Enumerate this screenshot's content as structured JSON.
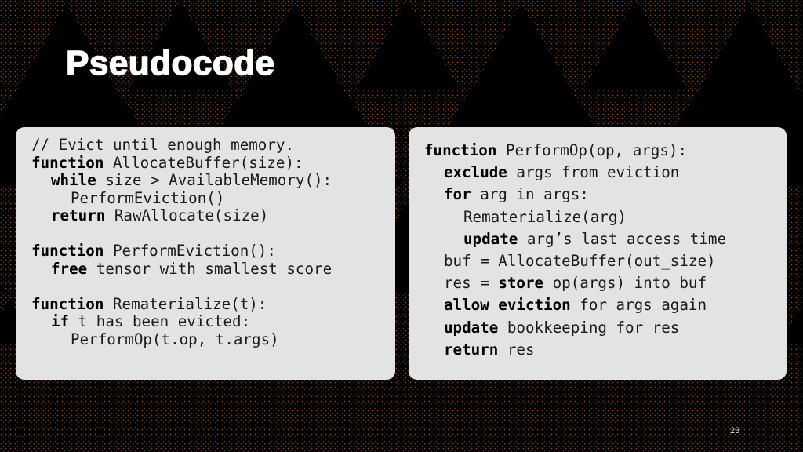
{
  "slide": {
    "title": "Pseudocode",
    "page_number": "23",
    "background": "sierpinski-triangle-pattern",
    "colors": {
      "background": "#000000",
      "pattern_dots": "#8a4a22",
      "panel": "#e3e3e3",
      "title_text": "#ffffff",
      "code_text": "#1a1a1a"
    }
  },
  "left_panel": {
    "lines": [
      {
        "indent": 0,
        "parts": [
          {
            "t": "// Evict until enough memory.",
            "b": false
          }
        ]
      },
      {
        "indent": 0,
        "parts": [
          {
            "t": "function",
            "b": true
          },
          {
            "t": " AllocateBuffer(size):",
            "b": false
          }
        ]
      },
      {
        "indent": 1,
        "parts": [
          {
            "t": "while",
            "b": true
          },
          {
            "t": " size > AvailableMemory():",
            "b": false
          }
        ]
      },
      {
        "indent": 2,
        "parts": [
          {
            "t": "PerformEviction()",
            "b": false
          }
        ]
      },
      {
        "indent": 1,
        "parts": [
          {
            "t": "return",
            "b": true
          },
          {
            "t": " RawAllocate(size)",
            "b": false
          }
        ]
      },
      {
        "indent": 0,
        "parts": []
      },
      {
        "indent": 0,
        "parts": [
          {
            "t": "function",
            "b": true
          },
          {
            "t": " PerformEviction():",
            "b": false
          }
        ]
      },
      {
        "indent": 1,
        "parts": [
          {
            "t": "free",
            "b": true
          },
          {
            "t": " tensor with smallest score",
            "b": false
          }
        ]
      },
      {
        "indent": 0,
        "parts": []
      },
      {
        "indent": 0,
        "parts": [
          {
            "t": "function",
            "b": true
          },
          {
            "t": " Rematerialize(t):",
            "b": false
          }
        ]
      },
      {
        "indent": 1,
        "parts": [
          {
            "t": "if",
            "b": true
          },
          {
            "t": " t has been evicted:",
            "b": false
          }
        ]
      },
      {
        "indent": 2,
        "parts": [
          {
            "t": "PerformOp(t.op, t.args)",
            "b": false
          }
        ]
      }
    ]
  },
  "right_panel": {
    "lines": [
      {
        "indent": 0,
        "parts": [
          {
            "t": "function",
            "b": true
          },
          {
            "t": " PerformOp(op, args):",
            "b": false
          }
        ]
      },
      {
        "indent": 1,
        "parts": [
          {
            "t": "exclude",
            "b": true
          },
          {
            "t": " args from eviction",
            "b": false
          }
        ]
      },
      {
        "indent": 1,
        "parts": [
          {
            "t": "for",
            "b": true
          },
          {
            "t": " arg in args:",
            "b": false
          }
        ]
      },
      {
        "indent": 2,
        "parts": [
          {
            "t": "Rematerialize(arg)",
            "b": false
          }
        ]
      },
      {
        "indent": 2,
        "parts": [
          {
            "t": "update",
            "b": true
          },
          {
            "t": " arg’s last access time",
            "b": false
          }
        ]
      },
      {
        "indent": 1,
        "parts": [
          {
            "t": "buf = AllocateBuffer(out_size)",
            "b": false
          }
        ]
      },
      {
        "indent": 1,
        "parts": [
          {
            "t": "res = ",
            "b": false
          },
          {
            "t": "store",
            "b": true
          },
          {
            "t": " op(args) into buf",
            "b": false
          }
        ]
      },
      {
        "indent": 1,
        "parts": [
          {
            "t": "allow eviction",
            "b": true
          },
          {
            "t": " for args again",
            "b": false
          }
        ]
      },
      {
        "indent": 1,
        "parts": [
          {
            "t": "update",
            "b": true
          },
          {
            "t": " bookkeeping for res",
            "b": false
          }
        ]
      },
      {
        "indent": 1,
        "parts": [
          {
            "t": "return",
            "b": true
          },
          {
            "t": " res",
            "b": false
          }
        ]
      }
    ]
  }
}
